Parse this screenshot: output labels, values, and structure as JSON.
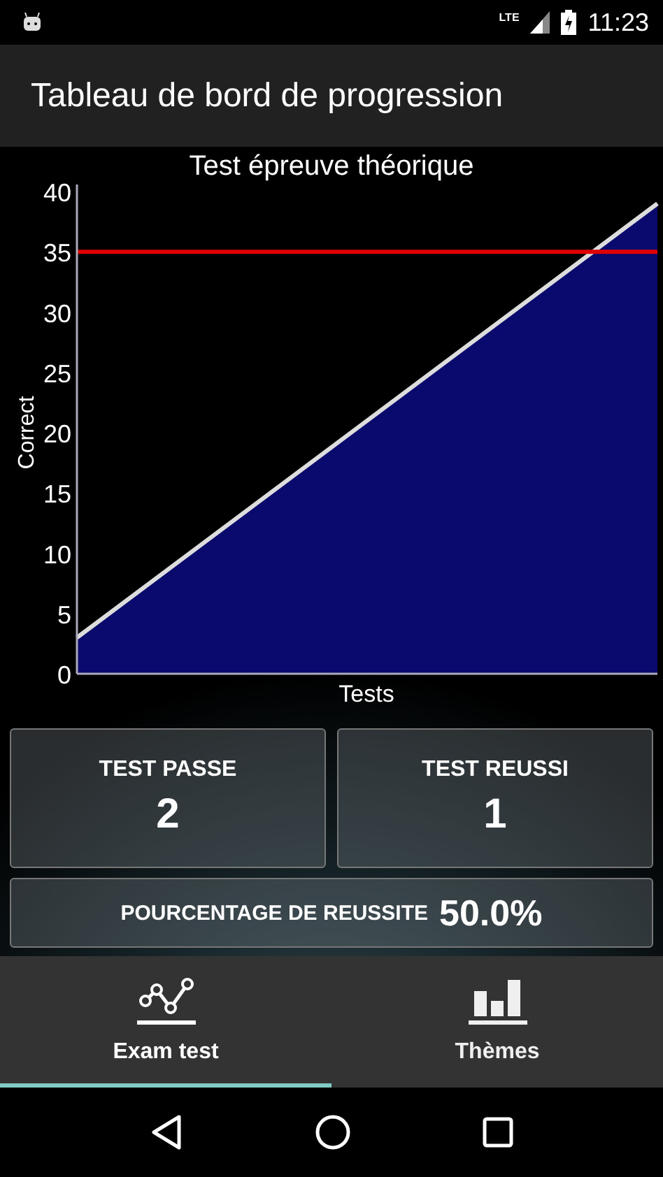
{
  "status_bar": {
    "time": "11:23",
    "network": "LTE"
  },
  "app_bar": {
    "title": "Tableau de bord de progression"
  },
  "chart": {
    "chart_data": {
      "type": "area",
      "title": "Test épreuve théorique",
      "xlabel": "Tests",
      "ylabel": "Correct",
      "series": [
        {
          "color": "#0a0a6e",
          "values": [
            3,
            39
          ]
        }
      ],
      "ylim": [
        0,
        40
      ],
      "yticks": [
        0,
        5,
        10,
        15,
        20,
        25,
        30,
        35,
        40
      ],
      "ref_lines": [
        {
          "axis": "y",
          "value": 35,
          "color": "#e00000"
        }
      ]
    }
  },
  "stats": [
    {
      "label": "TEST PASSE",
      "value": "2"
    },
    {
      "label": "TEST REUSSI",
      "value": "1"
    }
  ],
  "success": {
    "label": "POURCENTAGE DE REUSSITE",
    "value": "50.0%"
  },
  "tabs": [
    {
      "label": "Exam test",
      "selected": true
    },
    {
      "label": "Thèmes",
      "selected": false
    }
  ]
}
